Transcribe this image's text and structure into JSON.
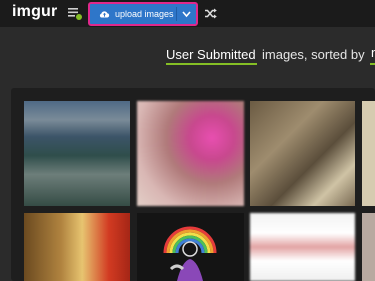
{
  "header": {
    "logo": "imgur",
    "upload_label": "upload images"
  },
  "sort": {
    "selected": "User Submitted",
    "middle_text": "images, sorted by",
    "next_option_partial": "n"
  },
  "icons": {
    "menu": "menu-icon",
    "upload": "cloud-upload-icon",
    "dropdown": "chevron-down-icon",
    "random": "shuffle-icon"
  },
  "colors": {
    "accent_green": "#85bf25",
    "upload_blue": "#2e76c9",
    "highlight_pink": "#e0288c"
  }
}
